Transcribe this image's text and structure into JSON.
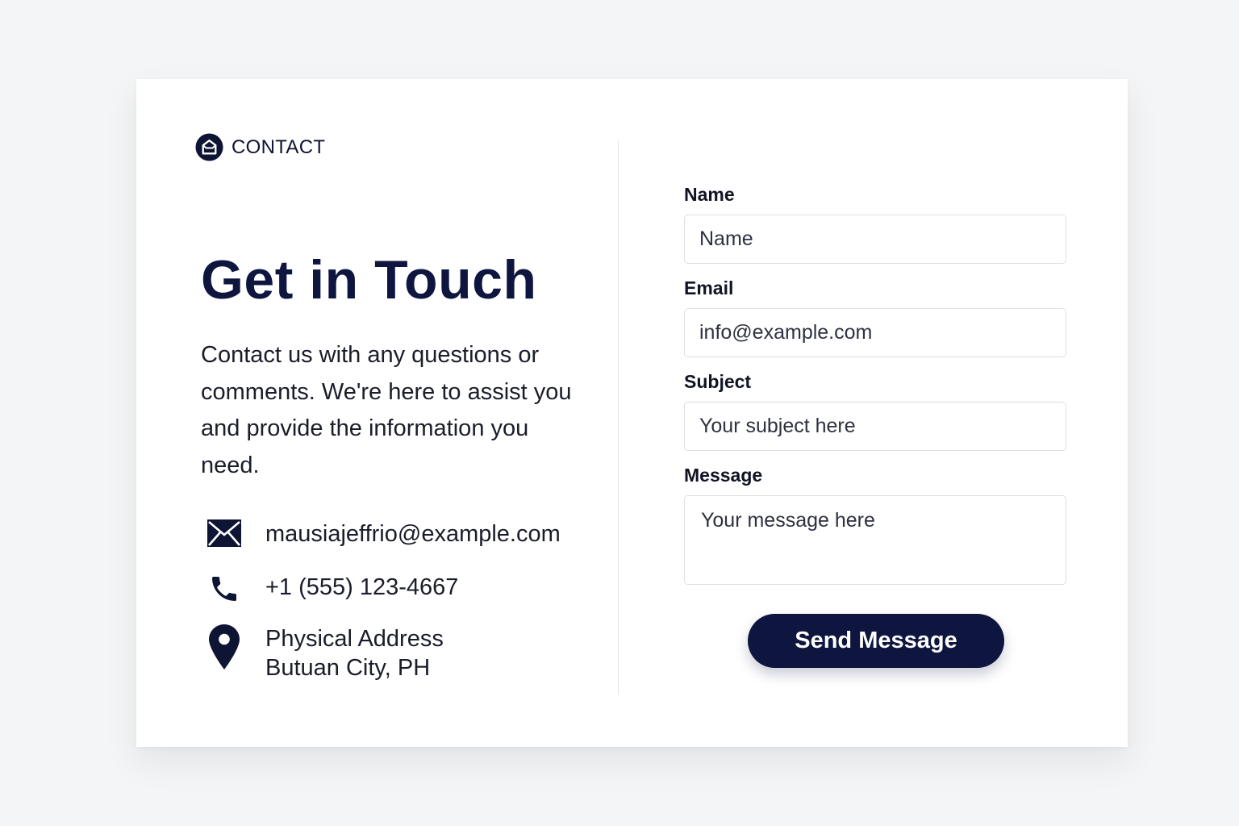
{
  "brand": {
    "label": "CONTACT",
    "icon": "contact-logo-icon"
  },
  "hero": {
    "title": "Get in Touch",
    "description": "Contact us with any questions or comments. We're here to assist you and provide the information you need."
  },
  "contact_info": {
    "email": {
      "icon": "envelope-icon",
      "value": "mausiajeffrio@example.com"
    },
    "phone": {
      "icon": "phone-icon",
      "value": "+1 (555) 123-4667"
    },
    "address": {
      "icon": "map-pin-icon",
      "line1": "Physical Address",
      "line2": "Butuan City, PH"
    }
  },
  "form": {
    "name": {
      "label": "Name",
      "placeholder": "Name"
    },
    "email": {
      "label": "Email",
      "placeholder": "info@example.com"
    },
    "subject": {
      "label": "Subject",
      "placeholder": "Your subject here"
    },
    "message": {
      "label": "Message",
      "placeholder": "Your message here"
    },
    "submit_label": "Send Message"
  },
  "colors": {
    "page_background": "#f3f5f6",
    "card_background": "#ffffff",
    "brand_navy": "#0e1640",
    "divider": "#e4e6ea",
    "input_border": "#dcdfe4"
  }
}
